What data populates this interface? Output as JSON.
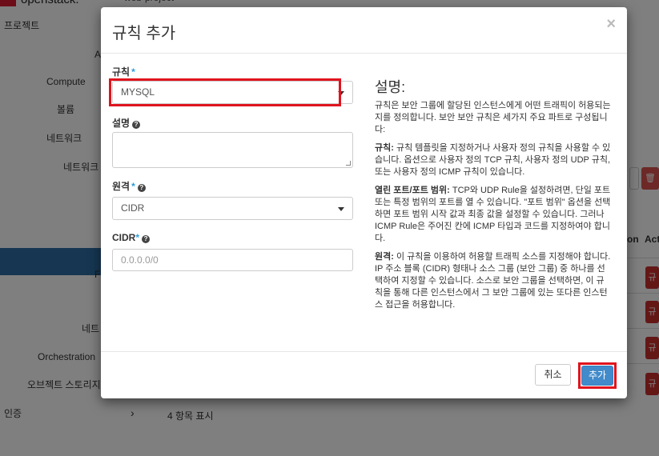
{
  "background": {
    "logo": "openstack.",
    "project": "web-project",
    "sidebar": [
      "프로젝트",
      "A",
      "Compute",
      "볼륨",
      "네트워크",
      "네트워크",
      "F",
      "네트",
      "Orchestration",
      "오브젝트 스토리지",
      "인증"
    ],
    "footer_count": "4 항목 표시",
    "right_col_labels": [
      "on",
      "Act"
    ],
    "right_buttons": [
      "규",
      "규",
      "규",
      "규"
    ]
  },
  "modal": {
    "title": "규칙 추가",
    "close": "×",
    "fields": {
      "rule_label": "규칙",
      "rule_value": "MYSQL",
      "description_label": "설명",
      "remote_label": "원격",
      "remote_value": "CIDR",
      "cidr_label": "CIDR",
      "cidr_placeholder": "0.0.0.0/0"
    },
    "help": {
      "title": "설명:",
      "p1": "규칙은 보안 그룹에 할당된 인스턴스에게 어떤 트래픽이 허용되는지를 정의합니다. 보안 보안 규칙은 세가지 주요 파트로 구성됩니다:",
      "p2_b": "규칙:",
      "p2": " 규칙 템플릿을 지정하거나 사용자 정의 규칙을 사용할 수 있습니다. 옵션으로 사용자 정의 TCP 규칙, 사용자 정의 UDP 규칙, 또는 사용자 정의 ICMP 규칙이 있습니다.",
      "p3_b": "열린 포트/포트 범위:",
      "p3": " TCP와 UDP Rule을 설정하려면, 단일 포트 또는 특정 범위의 포트를 열 수 있습니다. \"포트 범위\" 옵션을 선택하면 포트 범위 시작 값과 최종 값을 설정할 수 있습니다. 그러나 ICMP Rule은 주어진 칸에 ICMP 타입과 코드를 지정하여야 합니다.",
      "p4_b": "원격:",
      "p4": " 이 규칙을 이용하여 허용할 트래픽 소스를 지정해야 합니다. IP 주소 블록 (CIDR) 형태나 소스 그룹 (보안 그룹) 중 하나를 선택하여 지정할 수 있습니다. 소스로 보안 그룹을 선택하면, 이 규칙을 통해 다른 인스턴스에서 그 보안 그룹에 있는 또다른 인스턴스 접근을 허용합니다."
    },
    "buttons": {
      "cancel": "취소",
      "add": "추가"
    },
    "required_mark": "*",
    "help_mark": "?"
  },
  "colors": {
    "primary": "#428bca",
    "danger": "#c9302c",
    "highlight": "#e0141e",
    "required": "#2d9cdb"
  }
}
